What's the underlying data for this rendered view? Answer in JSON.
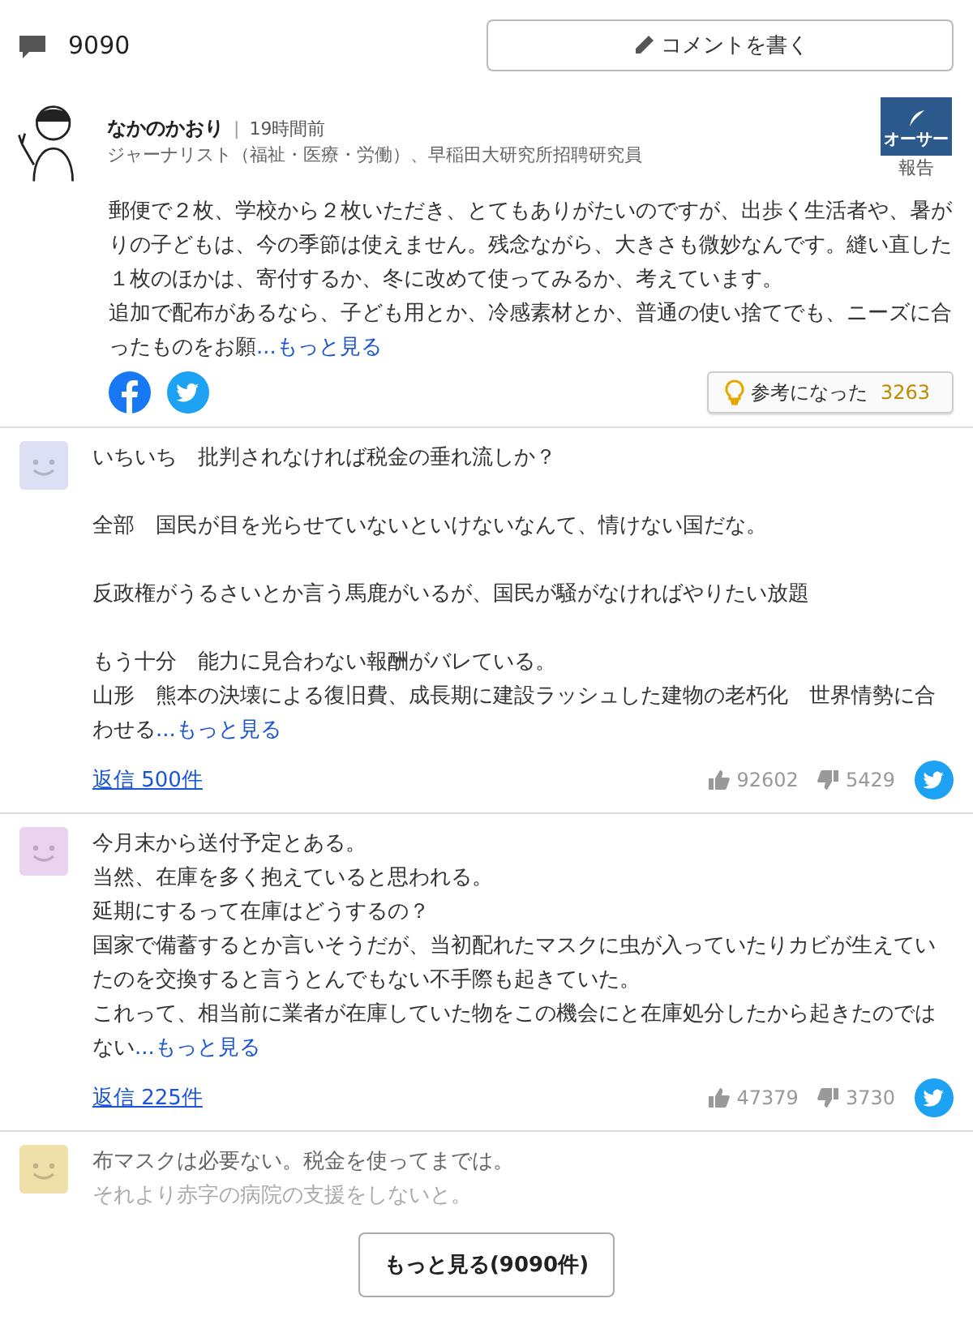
{
  "header": {
    "comment_count": "9090",
    "write_button": "コメントを書く"
  },
  "author_comment": {
    "name": "なかのかおり",
    "separator": "|",
    "time": "19時間前",
    "profile": "ジャーナリスト（福祉・医療・労働）、早稲田大研究所招聘研究員",
    "badge": "オーサー",
    "report": "報告",
    "paragraphs": [
      [
        "郵便で２枚、学校から２枚いただき、とてもありがたいのですが、出歩く生活者や、暑がりの子どもは、今の季節は使えません。残念ながら、大きさも微妙なんです。縫い直した１枚のほかは、寄付するか、冬に改めて使ってみるか、考えています。",
        "追加で配布があるなら、子ども用とか、冷感素材とか、普通の使い捨てでも、ニーズに合ったものをお願"
      ]
    ],
    "more": "...もっと見る",
    "helpful_label": "参考になった",
    "helpful_count": "3263"
  },
  "comments": [
    {
      "kind": "full",
      "color": "#dde0f5",
      "paragraphs": [
        [
          "いちいち　批判されなければ税金の垂れ流しか？"
        ],
        [
          "全部　国民が目を光らせていないといけないなんて、情けない国だな。"
        ],
        [
          "反政権がうるさいとか言う馬鹿がいるが、国民が騒がなければやりたい放題"
        ],
        [
          "もう十分　能力に見合わない報酬がバレている。",
          "山形　熊本の決壊による復旧費、成長期に建設ラッシュした建物の老朽化　世界情勢に合わせる"
        ]
      ],
      "more": "...もっと見る",
      "replies": "返信 500件",
      "likes": "92602",
      "dislikes": "5429"
    },
    {
      "kind": "full",
      "color": "#ead3ee",
      "paragraphs": [
        [
          "今月末から送付予定とある。",
          "当然、在庫を多く抱えていると思われる。",
          "延期にするって在庫はどうするの？",
          "国家で備蓄するとか言いそうだが、当初配れたマスクに虫が入っていたりカビが生えていたのを交換すると言うとんでもない不手際も起きていた。",
          "これって、相当前に業者が在庫していた物をこの機会にと在庫処分したから起きたのではない"
        ]
      ],
      "more": "...もっと見る",
      "replies": "返信 225件",
      "likes": "47379",
      "dislikes": "3730"
    },
    {
      "kind": "preview",
      "color": "#efdfa8",
      "paragraphs": [
        [
          "布マスクは必要ない。税金を使ってまでは。",
          "それより赤字の病院の支援をしないと。"
        ]
      ]
    }
  ],
  "more_button": "もっと見る(9090件)"
}
